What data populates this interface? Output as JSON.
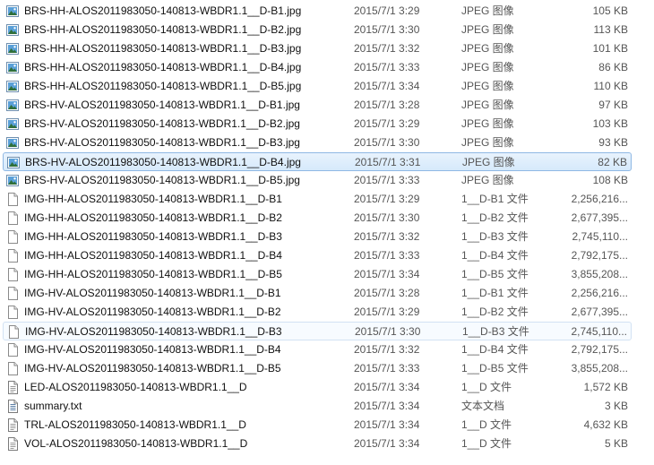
{
  "files": [
    {
      "name": "BRS-HH-ALOS2011983050-140813-WBDR1.1__D-B1.jpg",
      "date": "2015/7/1 3:29",
      "type": "JPEG 图像",
      "size": "105 KB",
      "icon": "jpeg-image-icon"
    },
    {
      "name": "BRS-HH-ALOS2011983050-140813-WBDR1.1__D-B2.jpg",
      "date": "2015/7/1 3:30",
      "type": "JPEG 图像",
      "size": "113 KB",
      "icon": "jpeg-image-icon"
    },
    {
      "name": "BRS-HH-ALOS2011983050-140813-WBDR1.1__D-B3.jpg",
      "date": "2015/7/1 3:32",
      "type": "JPEG 图像",
      "size": "101 KB",
      "icon": "jpeg-image-icon"
    },
    {
      "name": "BRS-HH-ALOS2011983050-140813-WBDR1.1__D-B4.jpg",
      "date": "2015/7/1 3:33",
      "type": "JPEG 图像",
      "size": "86 KB",
      "icon": "jpeg-image-icon"
    },
    {
      "name": "BRS-HH-ALOS2011983050-140813-WBDR1.1__D-B5.jpg",
      "date": "2015/7/1 3:34",
      "type": "JPEG 图像",
      "size": "110 KB",
      "icon": "jpeg-image-icon"
    },
    {
      "name": "BRS-HV-ALOS2011983050-140813-WBDR1.1__D-B1.jpg",
      "date": "2015/7/1 3:28",
      "type": "JPEG 图像",
      "size": "97 KB",
      "icon": "jpeg-image-icon"
    },
    {
      "name": "BRS-HV-ALOS2011983050-140813-WBDR1.1__D-B2.jpg",
      "date": "2015/7/1 3:29",
      "type": "JPEG 图像",
      "size": "103 KB",
      "icon": "jpeg-image-icon"
    },
    {
      "name": "BRS-HV-ALOS2011983050-140813-WBDR1.1__D-B3.jpg",
      "date": "2015/7/1 3:30",
      "type": "JPEG 图像",
      "size": "93 KB",
      "icon": "jpeg-image-icon"
    },
    {
      "name": "BRS-HV-ALOS2011983050-140813-WBDR1.1__D-B4.jpg",
      "date": "2015/7/1 3:31",
      "type": "JPEG 图像",
      "size": "82 KB",
      "icon": "jpeg-image-icon",
      "state": "selected"
    },
    {
      "name": "BRS-HV-ALOS2011983050-140813-WBDR1.1__D-B5.jpg",
      "date": "2015/7/1 3:33",
      "type": "JPEG 图像",
      "size": "108 KB",
      "icon": "jpeg-image-icon"
    },
    {
      "name": "IMG-HH-ALOS2011983050-140813-WBDR1.1__D-B1",
      "date": "2015/7/1 3:29",
      "type": "1__D-B1 文件",
      "size": "2,256,216...",
      "icon": "blank-file-icon"
    },
    {
      "name": "IMG-HH-ALOS2011983050-140813-WBDR1.1__D-B2",
      "date": "2015/7/1 3:30",
      "type": "1__D-B2 文件",
      "size": "2,677,395...",
      "icon": "blank-file-icon"
    },
    {
      "name": "IMG-HH-ALOS2011983050-140813-WBDR1.1__D-B3",
      "date": "2015/7/1 3:32",
      "type": "1__D-B3 文件",
      "size": "2,745,110...",
      "icon": "blank-file-icon"
    },
    {
      "name": "IMG-HH-ALOS2011983050-140813-WBDR1.1__D-B4",
      "date": "2015/7/1 3:33",
      "type": "1__D-B4 文件",
      "size": "2,792,175...",
      "icon": "blank-file-icon"
    },
    {
      "name": "IMG-HH-ALOS2011983050-140813-WBDR1.1__D-B5",
      "date": "2015/7/1 3:34",
      "type": "1__D-B5 文件",
      "size": "3,855,208...",
      "icon": "blank-file-icon"
    },
    {
      "name": "IMG-HV-ALOS2011983050-140813-WBDR1.1__D-B1",
      "date": "2015/7/1 3:28",
      "type": "1__D-B1 文件",
      "size": "2,256,216...",
      "icon": "blank-file-icon"
    },
    {
      "name": "IMG-HV-ALOS2011983050-140813-WBDR1.1__D-B2",
      "date": "2015/7/1 3:29",
      "type": "1__D-B2 文件",
      "size": "2,677,395...",
      "icon": "blank-file-icon"
    },
    {
      "name": "IMG-HV-ALOS2011983050-140813-WBDR1.1__D-B3",
      "date": "2015/7/1 3:30",
      "type": "1__D-B3 文件",
      "size": "2,745,110...",
      "icon": "blank-file-icon",
      "state": "hovered"
    },
    {
      "name": "IMG-HV-ALOS2011983050-140813-WBDR1.1__D-B4",
      "date": "2015/7/1 3:32",
      "type": "1__D-B4 文件",
      "size": "2,792,175...",
      "icon": "blank-file-icon"
    },
    {
      "name": "IMG-HV-ALOS2011983050-140813-WBDR1.1__D-B5",
      "date": "2015/7/1 3:33",
      "type": "1__D-B5 文件",
      "size": "3,855,208...",
      "icon": "blank-file-icon"
    },
    {
      "name": "LED-ALOS2011983050-140813-WBDR1.1__D",
      "date": "2015/7/1 3:34",
      "type": "1__D 文件",
      "size": "1,572 KB",
      "icon": "document-file-icon"
    },
    {
      "name": "summary.txt",
      "date": "2015/7/1 3:34",
      "type": "文本文档",
      "size": "3 KB",
      "icon": "text-file-icon"
    },
    {
      "name": "TRL-ALOS2011983050-140813-WBDR1.1__D",
      "date": "2015/7/1 3:34",
      "type": "1__D 文件",
      "size": "4,632 KB",
      "icon": "document-file-icon"
    },
    {
      "name": "VOL-ALOS2011983050-140813-WBDR1.1__D",
      "date": "2015/7/1 3:34",
      "type": "1__D 文件",
      "size": "5 KB",
      "icon": "document-file-icon"
    }
  ]
}
